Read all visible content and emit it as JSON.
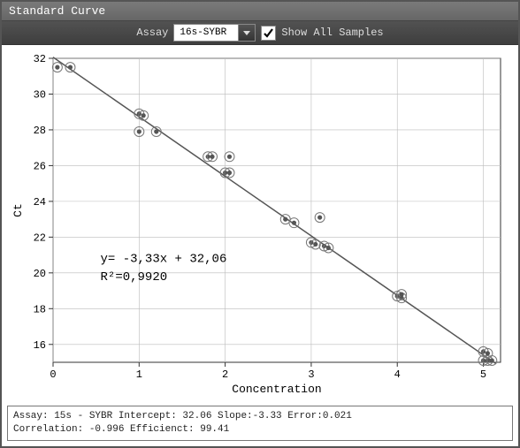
{
  "window": {
    "title": "Standard Curve"
  },
  "toolbar": {
    "assay_label": "Assay",
    "assay_value": "16s-SYBR",
    "show_all_label": "Show All Samples",
    "show_all_checked": true
  },
  "annotation": {
    "line1": "y= -3,33x + 32,06",
    "line2": "R²=0,9920"
  },
  "footer": {
    "line1": "Assay: 15s - SYBR Intercept: 32.06 Slope:-3.33  Error:0.021",
    "line2": "Correlation: -0.996 Efficienct: 99.41"
  },
  "chart_data": {
    "type": "scatter",
    "title": "Standard Curve",
    "xlabel": "Concentration",
    "ylabel": "Ct",
    "xlim": [
      0,
      5.2
    ],
    "ylim": [
      15,
      32
    ],
    "xticks": [
      0,
      1,
      2,
      3,
      4,
      5
    ],
    "yticks": [
      16,
      18,
      20,
      22,
      24,
      26,
      28,
      30,
      32
    ],
    "series": [
      {
        "name": "samples",
        "points": [
          {
            "x": 0.05,
            "y": 31.5
          },
          {
            "x": 0.2,
            "y": 31.5
          },
          {
            "x": 1.0,
            "y": 28.9
          },
          {
            "x": 1.05,
            "y": 28.8
          },
          {
            "x": 1.0,
            "y": 27.9
          },
          {
            "x": 1.2,
            "y": 27.9
          },
          {
            "x": 1.8,
            "y": 26.5
          },
          {
            "x": 1.85,
            "y": 26.5
          },
          {
            "x": 2.0,
            "y": 25.6
          },
          {
            "x": 2.05,
            "y": 25.6
          },
          {
            "x": 2.05,
            "y": 26.5
          },
          {
            "x": 2.7,
            "y": 23.0
          },
          {
            "x": 2.8,
            "y": 22.8
          },
          {
            "x": 3.0,
            "y": 21.7
          },
          {
            "x": 3.05,
            "y": 21.6
          },
          {
            "x": 3.15,
            "y": 21.5
          },
          {
            "x": 3.2,
            "y": 21.4
          },
          {
            "x": 3.1,
            "y": 23.1
          },
          {
            "x": 4.0,
            "y": 18.7
          },
          {
            "x": 4.05,
            "y": 18.6
          },
          {
            "x": 4.05,
            "y": 18.8
          },
          {
            "x": 5.0,
            "y": 15.6
          },
          {
            "x": 5.05,
            "y": 15.5
          },
          {
            "x": 5.0,
            "y": 15.1
          },
          {
            "x": 5.05,
            "y": 15.1
          },
          {
            "x": 5.1,
            "y": 15.1
          }
        ]
      }
    ],
    "fit": {
      "slope": -3.33,
      "intercept": 32.06,
      "r2": 0.992
    }
  }
}
